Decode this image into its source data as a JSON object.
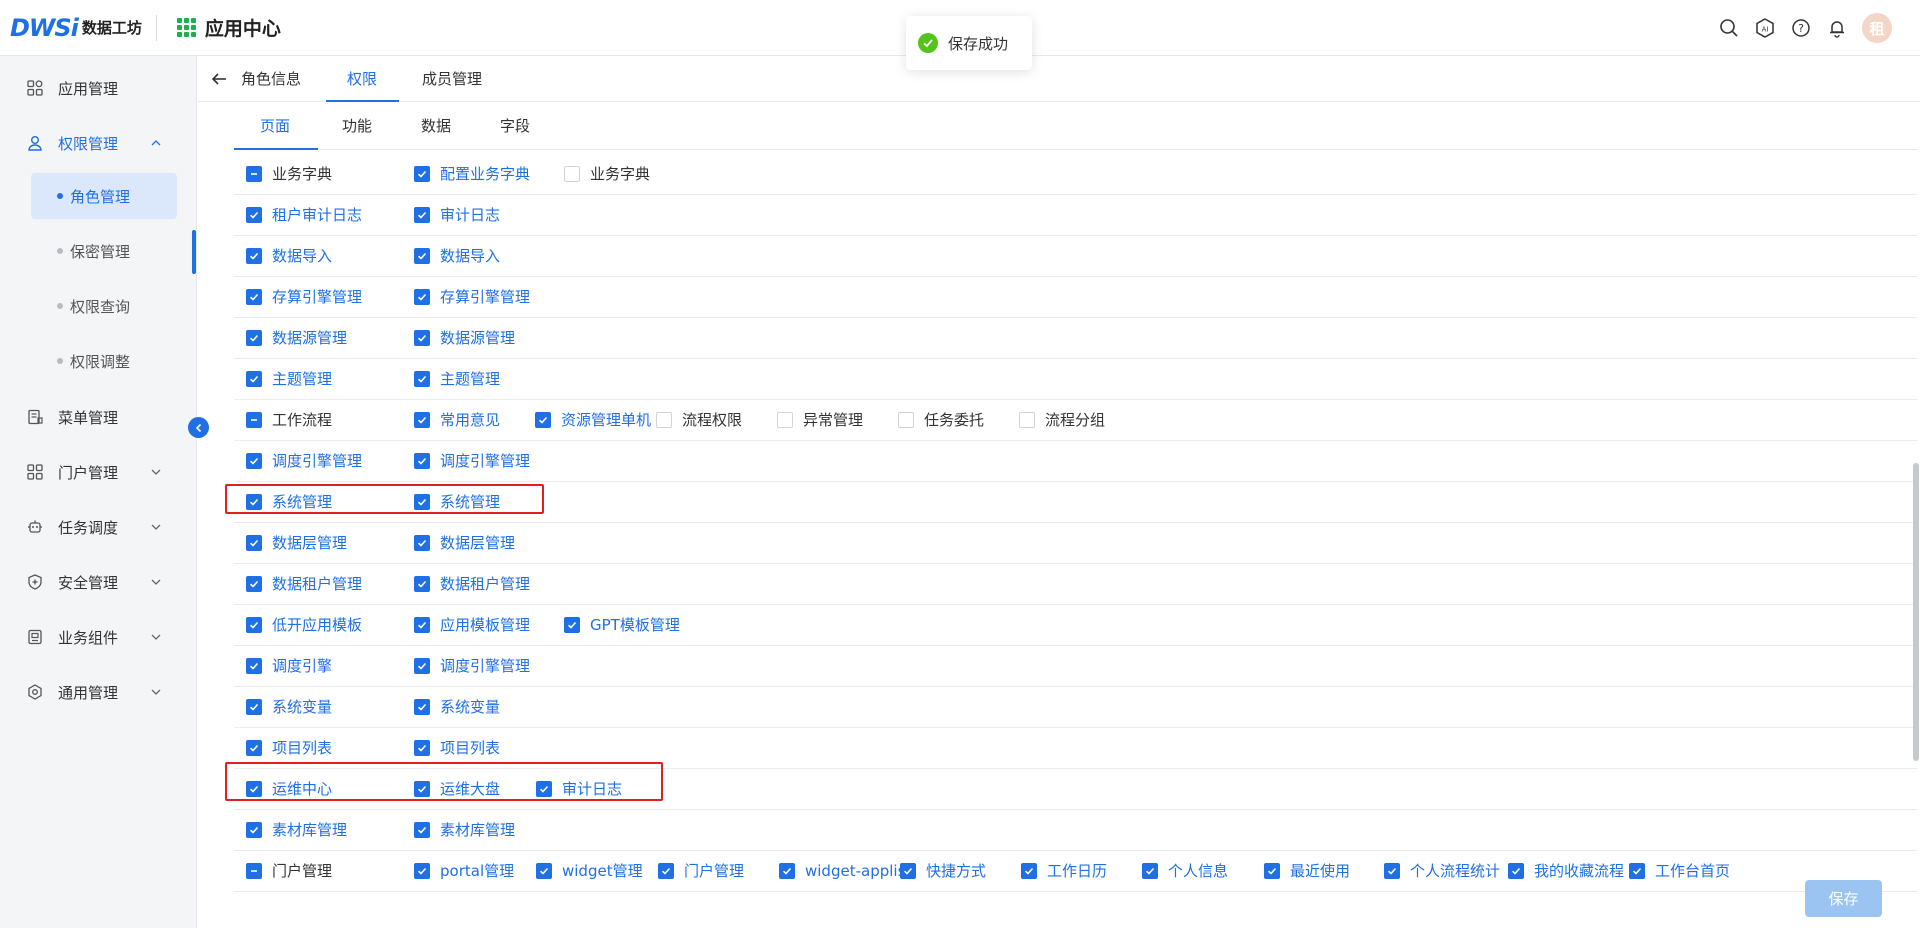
{
  "header": {
    "logo_mark": "DWSi",
    "logo_text": "数据工坊",
    "app_title": "应用中心",
    "avatar_text": "租"
  },
  "toast": {
    "message": "保存成功"
  },
  "sidebar": {
    "items": [
      {
        "label": "应用管理",
        "icon": "apps-icon"
      },
      {
        "label": "权限管理",
        "icon": "user-icon"
      },
      {
        "label": "菜单管理",
        "icon": "menu-doc-icon"
      },
      {
        "label": "门户管理",
        "icon": "portal-icon"
      },
      {
        "label": "任务调度",
        "icon": "robot-icon"
      },
      {
        "label": "安全管理",
        "icon": "shield-icon"
      },
      {
        "label": "业务组件",
        "icon": "component-icon"
      },
      {
        "label": "通用管理",
        "icon": "settings-icon"
      }
    ],
    "sub_items": [
      "角色管理",
      "保密管理",
      "权限查询",
      "权限调整"
    ]
  },
  "tabs_top": [
    "角色信息",
    "权限",
    "成员管理"
  ],
  "tabs_sub": [
    "页面",
    "功能",
    "数据",
    "字段"
  ],
  "rows": [
    {
      "parent": "业务字典",
      "parent_state": "indeterminate",
      "children": [
        {
          "label": "配置业务字典",
          "checked": true
        },
        {
          "label": "业务字典",
          "checked": false
        }
      ]
    },
    {
      "parent": "租户审计日志",
      "parent_state": "checked",
      "children": [
        {
          "label": "审计日志",
          "checked": true
        }
      ]
    },
    {
      "parent": "数据导入",
      "parent_state": "checked",
      "children": [
        {
          "label": "数据导入",
          "checked": true
        }
      ]
    },
    {
      "parent": "存算引擎管理",
      "parent_state": "checked",
      "children": [
        {
          "label": "存算引擎管理",
          "checked": true
        }
      ]
    },
    {
      "parent": "数据源管理",
      "parent_state": "checked",
      "children": [
        {
          "label": "数据源管理",
          "checked": true
        }
      ]
    },
    {
      "parent": "主题管理",
      "parent_state": "checked",
      "children": [
        {
          "label": "主题管理",
          "checked": true
        }
      ]
    },
    {
      "parent": "工作流程",
      "parent_state": "indeterminate",
      "children": [
        {
          "label": "常用意见",
          "checked": true
        },
        {
          "label": "资源管理单机",
          "checked": true
        },
        {
          "label": "流程权限",
          "checked": false
        },
        {
          "label": "异常管理",
          "checked": false
        },
        {
          "label": "任务委托",
          "checked": false
        },
        {
          "label": "流程分组",
          "checked": false
        }
      ]
    },
    {
      "parent": "调度引擎管理",
      "parent_state": "checked",
      "children": [
        {
          "label": "调度引擎管理",
          "checked": true
        }
      ]
    },
    {
      "parent": "系统管理",
      "parent_state": "checked",
      "children": [
        {
          "label": "系统管理",
          "checked": true
        }
      ]
    },
    {
      "parent": "数据层管理",
      "parent_state": "checked",
      "children": [
        {
          "label": "数据层管理",
          "checked": true
        }
      ]
    },
    {
      "parent": "数据租户管理",
      "parent_state": "checked",
      "children": [
        {
          "label": "数据租户管理",
          "checked": true
        }
      ]
    },
    {
      "parent": "低开应用模板",
      "parent_state": "checked",
      "children": [
        {
          "label": "应用模板管理",
          "checked": true
        },
        {
          "label": "GPT模板管理",
          "checked": true
        }
      ]
    },
    {
      "parent": "调度引擎",
      "parent_state": "checked",
      "children": [
        {
          "label": "调度引擎管理",
          "checked": true
        }
      ]
    },
    {
      "parent": "系统变量",
      "parent_state": "checked",
      "children": [
        {
          "label": "系统变量",
          "checked": true
        }
      ]
    },
    {
      "parent": "项目列表",
      "parent_state": "checked",
      "children": [
        {
          "label": "项目列表",
          "checked": true
        }
      ]
    },
    {
      "parent": "运维中心",
      "parent_state": "checked",
      "children": [
        {
          "label": "运维大盘",
          "checked": true
        },
        {
          "label": "审计日志",
          "checked": true
        }
      ]
    },
    {
      "parent": "素材库管理",
      "parent_state": "checked",
      "children": [
        {
          "label": "素材库管理",
          "checked": true
        }
      ]
    },
    {
      "parent": "门户管理",
      "parent_state": "indeterminate",
      "children": [
        {
          "label": "portal管理",
          "checked": true
        },
        {
          "label": "widget管理",
          "checked": true
        },
        {
          "label": "门户管理",
          "checked": true
        },
        {
          "label": "widget-applist",
          "checked": true
        },
        {
          "label": "快捷方式",
          "checked": true
        },
        {
          "label": "工作日历",
          "checked": true
        },
        {
          "label": "个人信息",
          "checked": true
        },
        {
          "label": "最近使用",
          "checked": true
        },
        {
          "label": "个人流程统计",
          "checked": true
        },
        {
          "label": "我的收藏流程",
          "checked": true
        },
        {
          "label": "工作台首页",
          "checked": true
        }
      ]
    }
  ],
  "save_button": "保存",
  "colors": {
    "accent": "#1f6fe5",
    "success": "#52c41a",
    "highlight": "#e02020"
  }
}
